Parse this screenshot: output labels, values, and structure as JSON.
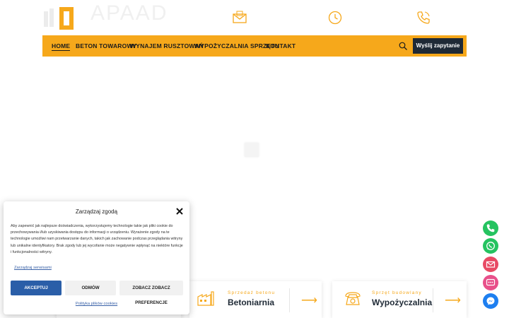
{
  "brand": {
    "name": "APAAD",
    "tagline": ""
  },
  "header": {
    "contacts": [
      {
        "icon": "email-icon",
        "text": ""
      },
      {
        "icon": "clock-icon",
        "text": ""
      },
      {
        "icon": "phone-icon",
        "text": ""
      }
    ]
  },
  "nav": {
    "items": [
      {
        "label": "HOME",
        "active": true
      },
      {
        "label": "BETON TOWAROWY",
        "active": false
      },
      {
        "label": "WYNAJEM RUSZTOWAŃ",
        "active": false
      },
      {
        "label": "WYPOŻYCZALNIA SPRZĘTU",
        "active": false
      },
      {
        "label": "KONTAKT",
        "active": false
      }
    ],
    "search_icon": "search-icon",
    "cta_label": "Wyślij zapytanie"
  },
  "cards": [
    {
      "kicker": "",
      "title": ""
    },
    {
      "kicker": "Sprzedaż betonu",
      "title": "Betoniarnia"
    },
    {
      "kicker": "Sprzęt budowlany",
      "title": "Wypożyczalnia"
    }
  ],
  "consent": {
    "title": "Zarządzaj zgodą",
    "text": "Aby zapewnić jak najlepsze doświadczenia, wykorzystujemy technologie takie jak pliki cookie do przechowywania i/lub uzyskiwania dostępu do informacji o urządzeniu. Wyrażenie zgody na te technologie umożliwi nam przetwarzanie danych, takich jak zachowanie podczas przeglądania witryny lub unikalne identyfikatory. Brak zgody lub jej wycofanie może negatywnie wpłynąć na niektóre funkcje i funkcjonalności witryny.",
    "manage_link": "Zarządzaj serwisami",
    "accept_label": "AKCEPTUJ",
    "deny_label": "ODMÓW",
    "prefs_label": "ZOBACZ ZOBACZ PREFERENCJE",
    "policy_link": "Polityka plików cookies"
  },
  "floating": [
    {
      "name": "phone-float-icon",
      "color": "#25c360"
    },
    {
      "name": "whatsapp-float-icon",
      "color": "#25c360"
    },
    {
      "name": "email-float-icon",
      "color": "#e84a64"
    },
    {
      "name": "sms-float-icon",
      "color": "#e8508a"
    },
    {
      "name": "messenger-float-icon",
      "color": "#1e7ff0"
    }
  ],
  "colors": {
    "accent": "#f6a81b",
    "dark": "#1f2a36",
    "link": "#3a62a8",
    "accept": "#2a5ea8"
  }
}
